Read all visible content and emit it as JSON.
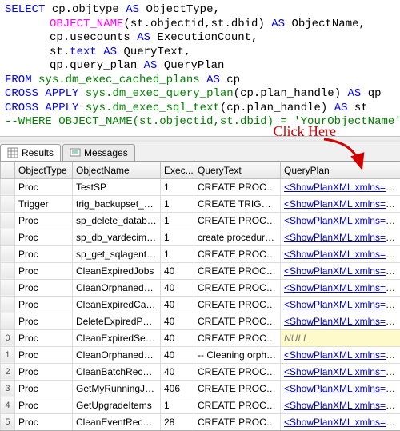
{
  "sql": {
    "l1a": "SELECT",
    "l1b": " cp.objtype ",
    "l1c": "AS",
    "l1d": " ObjectType,",
    "l2a": "OBJECT_NAME",
    "l2b": "(st.objectid,st.dbid) ",
    "l2c": "AS",
    "l2d": " ObjectName,",
    "l3a": "cp.usecounts ",
    "l3b": "AS",
    "l3c": " ExecutionCount,",
    "l4a": "st.",
    "l4b": "text",
    "l4c": " ",
    "l4d": "AS",
    "l4e": " QueryText,",
    "l5a": "qp.query_plan ",
    "l5b": "AS",
    "l5c": " QueryPlan",
    "l6a": "FROM",
    "l6b": " sys.dm_exec_cached_plans",
    "l6c": " ",
    "l6d": "AS",
    "l6e": " cp",
    "l7a": "CROSS",
    "l7b": " ",
    "l7c": "APPLY",
    "l7d": " sys.dm_exec_query_plan",
    "l7e": "(cp.plan_handle) ",
    "l7f": "AS",
    "l7g": " qp",
    "l8a": "CROSS",
    "l8b": " ",
    "l8c": "APPLY",
    "l8d": " sys.dm_exec_sql_text",
    "l8e": "(cp.plan_handle) ",
    "l8f": "AS",
    "l8g": " st",
    "l9": "--WHERE OBJECT_NAME(st.objectid,st.dbid) = 'YourObjectName'"
  },
  "hint": "Click Here",
  "tabs": {
    "results": "Results",
    "messages": "Messages"
  },
  "headers": {
    "objtype": "ObjectType",
    "objname": "ObjectName",
    "exec": "Exec...",
    "qtext": "QueryText",
    "qplan": "QueryPlan"
  },
  "plan_link": "<ShowPlanXML xmlns=\"http",
  "null_text": "NULL",
  "rows": [
    {
      "n": "",
      "objtype": "Proc",
      "objname": "TestSP",
      "exec": "1",
      "qtext": "CREATE PROCED...",
      "plan": true
    },
    {
      "n": "",
      "objtype": "Trigger",
      "objname": "trig_backupset_d...",
      "exec": "1",
      "qtext": "CREATE TRIGGE...",
      "plan": true
    },
    {
      "n": "",
      "objtype": "Proc",
      "objname": "sp_delete_databa...",
      "exec": "1",
      "qtext": "CREATE  PROCE...",
      "plan": true
    },
    {
      "n": "",
      "objtype": "Proc",
      "objname": "sp_db_vardecima...",
      "exec": "1",
      "qtext": "create procedure s...",
      "plan": true
    },
    {
      "n": "",
      "objtype": "Proc",
      "objname": "sp_get_sqlagent_...",
      "exec": "1",
      "qtext": "CREATE PROCE...",
      "plan": true
    },
    {
      "n": "",
      "objtype": "Proc",
      "objname": "CleanExpiredJobs",
      "exec": "40",
      "qtext": "CREATE PROCE...",
      "plan": true
    },
    {
      "n": "",
      "objtype": "Proc",
      "objname": "CleanOrphanedTes",
      "exec": "40",
      "qtext": "CREATE PROCE...",
      "plan": true
    },
    {
      "n": "",
      "objtype": "Proc",
      "objname": "CleanExpiredCache",
      "exec": "40",
      "qtext": "CREATE PROCE...",
      "plan": true
    },
    {
      "n": "",
      "objtype": "Proc",
      "objname": "DeleteExpiredPer...",
      "exec": "40",
      "qtext": "CREATE PROCE...",
      "plan": true
    },
    {
      "n": "0",
      "objtype": "Proc",
      "objname": "CleanExpiredSess...",
      "exec": "40",
      "qtext": "CREATE PROCE...",
      "plan": false
    },
    {
      "n": "1",
      "objtype": "Proc",
      "objname": "CleanOrphanedP...",
      "exec": "40",
      "qtext": "-- Cleaning orphan...",
      "plan": true
    },
    {
      "n": "2",
      "objtype": "Proc",
      "objname": "CleanBatchRecor...",
      "exec": "40",
      "qtext": "CREATE PROCE...",
      "plan": true
    },
    {
      "n": "3",
      "objtype": "Proc",
      "objname": "GetMyRunningJobs",
      "exec": "406",
      "qtext": "CREATE PROCE...",
      "plan": true
    },
    {
      "n": "4",
      "objtype": "Proc",
      "objname": "GetUpgradeItems",
      "exec": "1",
      "qtext": "CREATE PROCE...",
      "plan": true
    },
    {
      "n": "5",
      "objtype": "Proc",
      "objname": "CleanEventRecor...",
      "exec": "28",
      "qtext": "CREATE PROCE...",
      "plan": true
    }
  ]
}
